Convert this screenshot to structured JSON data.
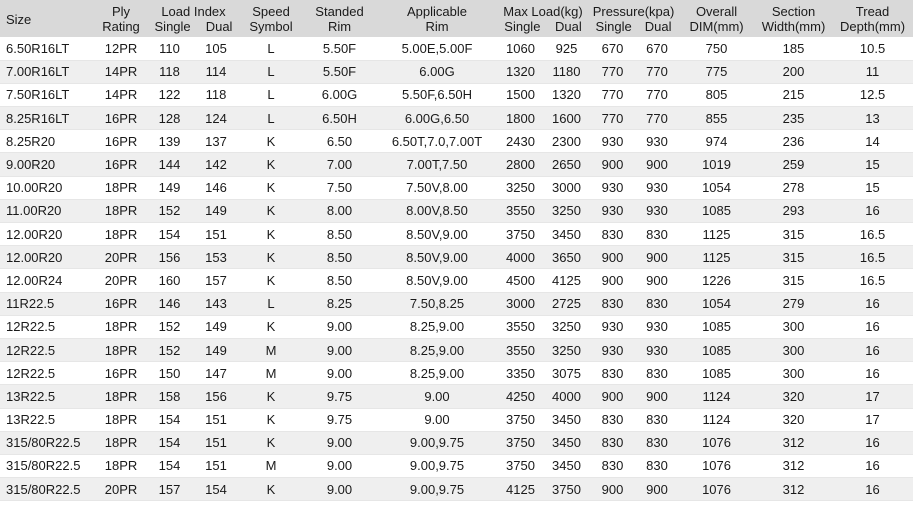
{
  "headers": {
    "size": "Size",
    "ply": [
      "Ply",
      "Rating"
    ],
    "load_index": "Load Index",
    "load_single": "Single",
    "load_dual": "Dual",
    "speed": [
      "Speed",
      "Symbol"
    ],
    "rim": [
      "Standed",
      "Rim"
    ],
    "app_rim": [
      "Applicable",
      "Rim"
    ],
    "max_load": "Max Load(kg)",
    "max_single": "Single",
    "max_dual": "Dual",
    "pressure": "Pressure(kpa)",
    "pres_single": "Single",
    "pres_dual": "Dual",
    "overall": [
      "Overall",
      "DIM(mm)"
    ],
    "section": [
      "Section",
      "Width(mm)"
    ],
    "tread": [
      "Tread",
      "Depth(mm)"
    ]
  },
  "rows": [
    [
      "6.50R16LT",
      "12PR",
      "110",
      "105",
      "L",
      "5.50F",
      "5.00E,5.00F",
      "1060",
      "925",
      "670",
      "670",
      "750",
      "185",
      "10.5"
    ],
    [
      "7.00R16LT",
      "14PR",
      "118",
      "114",
      "L",
      "5.50F",
      "6.00G",
      "1320",
      "1180",
      "770",
      "770",
      "775",
      "200",
      "11"
    ],
    [
      "7.50R16LT",
      "14PR",
      "122",
      "118",
      "L",
      "6.00G",
      "5.50F,6.50H",
      "1500",
      "1320",
      "770",
      "770",
      "805",
      "215",
      "12.5"
    ],
    [
      "8.25R16LT",
      "16PR",
      "128",
      "124",
      "L",
      "6.50H",
      "6.00G,6.50",
      "1800",
      "1600",
      "770",
      "770",
      "855",
      "235",
      "13"
    ],
    [
      "8.25R20",
      "16PR",
      "139",
      "137",
      "K",
      "6.50",
      "6.50T,7.0,7.00T",
      "2430",
      "2300",
      "930",
      "930",
      "974",
      "236",
      "14"
    ],
    [
      "9.00R20",
      "16PR",
      "144",
      "142",
      "K",
      "7.00",
      "7.00T,7.50",
      "2800",
      "2650",
      "900",
      "900",
      "1019",
      "259",
      "15"
    ],
    [
      "10.00R20",
      "18PR",
      "149",
      "146",
      "K",
      "7.50",
      "7.50V,8.00",
      "3250",
      "3000",
      "930",
      "930",
      "1054",
      "278",
      "15"
    ],
    [
      "11.00R20",
      "18PR",
      "152",
      "149",
      "K",
      "8.00",
      "8.00V,8.50",
      "3550",
      "3250",
      "930",
      "930",
      "1085",
      "293",
      "16"
    ],
    [
      "12.00R20",
      "18PR",
      "154",
      "151",
      "K",
      "8.50",
      "8.50V,9.00",
      "3750",
      "3450",
      "830",
      "830",
      "1125",
      "315",
      "16.5"
    ],
    [
      "12.00R20",
      "20PR",
      "156",
      "153",
      "K",
      "8.50",
      "8.50V,9.00",
      "4000",
      "3650",
      "900",
      "900",
      "1125",
      "315",
      "16.5"
    ],
    [
      "12.00R24",
      "20PR",
      "160",
      "157",
      "K",
      "8.50",
      "8.50V,9.00",
      "4500",
      "4125",
      "900",
      "900",
      "1226",
      "315",
      "16.5"
    ],
    [
      "11R22.5",
      "16PR",
      "146",
      "143",
      "L",
      "8.25",
      "7.50,8.25",
      "3000",
      "2725",
      "830",
      "830",
      "1054",
      "279",
      "16"
    ],
    [
      "12R22.5",
      "18PR",
      "152",
      "149",
      "K",
      "9.00",
      "8.25,9.00",
      "3550",
      "3250",
      "930",
      "930",
      "1085",
      "300",
      "16"
    ],
    [
      "12R22.5",
      "18PR",
      "152",
      "149",
      "M",
      "9.00",
      "8.25,9.00",
      "3550",
      "3250",
      "930",
      "930",
      "1085",
      "300",
      "16"
    ],
    [
      "12R22.5",
      "16PR",
      "150",
      "147",
      "M",
      "9.00",
      "8.25,9.00",
      "3350",
      "3075",
      "830",
      "830",
      "1085",
      "300",
      "16"
    ],
    [
      "13R22.5",
      "18PR",
      "158",
      "156",
      "K",
      "9.75",
      "9.00",
      "4250",
      "4000",
      "900",
      "900",
      "1124",
      "320",
      "17"
    ],
    [
      "13R22.5",
      "18PR",
      "154",
      "151",
      "K",
      "9.75",
      "9.00",
      "3750",
      "3450",
      "830",
      "830",
      "1124",
      "320",
      "17"
    ],
    [
      "315/80R22.5",
      "18PR",
      "154",
      "151",
      "K",
      "9.00",
      "9.00,9.75",
      "3750",
      "3450",
      "830",
      "830",
      "1076",
      "312",
      "16"
    ],
    [
      "315/80R22.5",
      "18PR",
      "154",
      "151",
      "M",
      "9.00",
      "9.00,9.75",
      "3750",
      "3450",
      "830",
      "830",
      "1076",
      "312",
      "16"
    ],
    [
      "315/80R22.5",
      "20PR",
      "157",
      "154",
      "K",
      "9.00",
      "9.00,9.75",
      "4125",
      "3750",
      "900",
      "900",
      "1076",
      "312",
      "16"
    ]
  ]
}
